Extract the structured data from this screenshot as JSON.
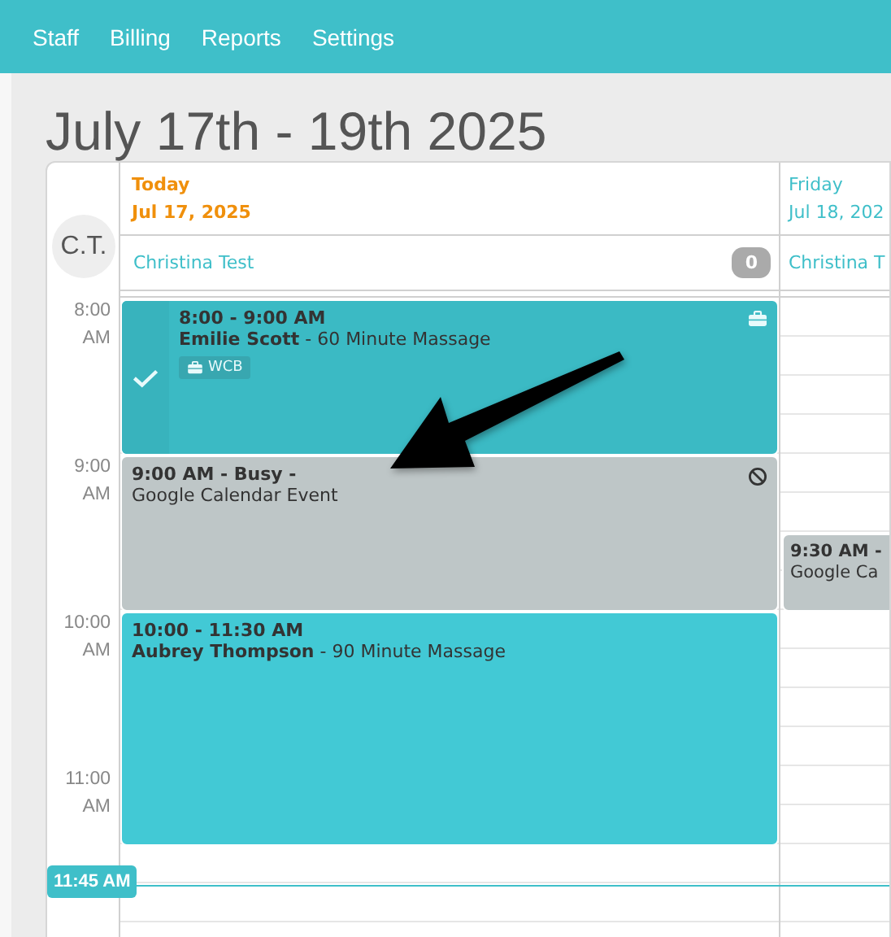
{
  "nav": {
    "items": [
      "Staff",
      "Billing",
      "Reports",
      "Settings"
    ]
  },
  "title": "July 17th - 19th 2025",
  "calendar": {
    "staff_initials": "C.T.",
    "time_labels": [
      {
        "hour": "8:00",
        "period": "AM"
      },
      {
        "hour": "9:00",
        "period": "AM"
      },
      {
        "hour": "10:00",
        "period": "AM"
      },
      {
        "hour": "11:00",
        "period": "AM"
      }
    ],
    "days": [
      {
        "weekday": "Today",
        "date": "Jul 17, 2025",
        "today": true,
        "staff": "Christina Test",
        "count": "0",
        "events": [
          {
            "kind": "hour-appointment",
            "time": "8:00 - 9:00 AM",
            "client": "Emilie Scott",
            "service": " - 60 Minute Massage",
            "checked_in": true,
            "tag": "WCB"
          },
          {
            "kind": "hour-busy",
            "title": "9:00 AM - Busy -",
            "subtitle": "Google Calendar Event"
          },
          {
            "kind": "long-appointment",
            "time": "10:00 - 11:30 AM",
            "client": "Aubrey Thompson",
            "service": " - 90 Minute Massage",
            "checked_in": false
          }
        ]
      },
      {
        "weekday": "Friday",
        "date": "Jul 18, 202",
        "today": false,
        "staff": "Christina T",
        "events": [
          {
            "kind": "long-gap"
          },
          {
            "kind": "short-busy",
            "title": "9:30 AM -",
            "subtitle": "Google Ca"
          }
        ]
      }
    ],
    "now_label": "11:45 AM"
  }
}
